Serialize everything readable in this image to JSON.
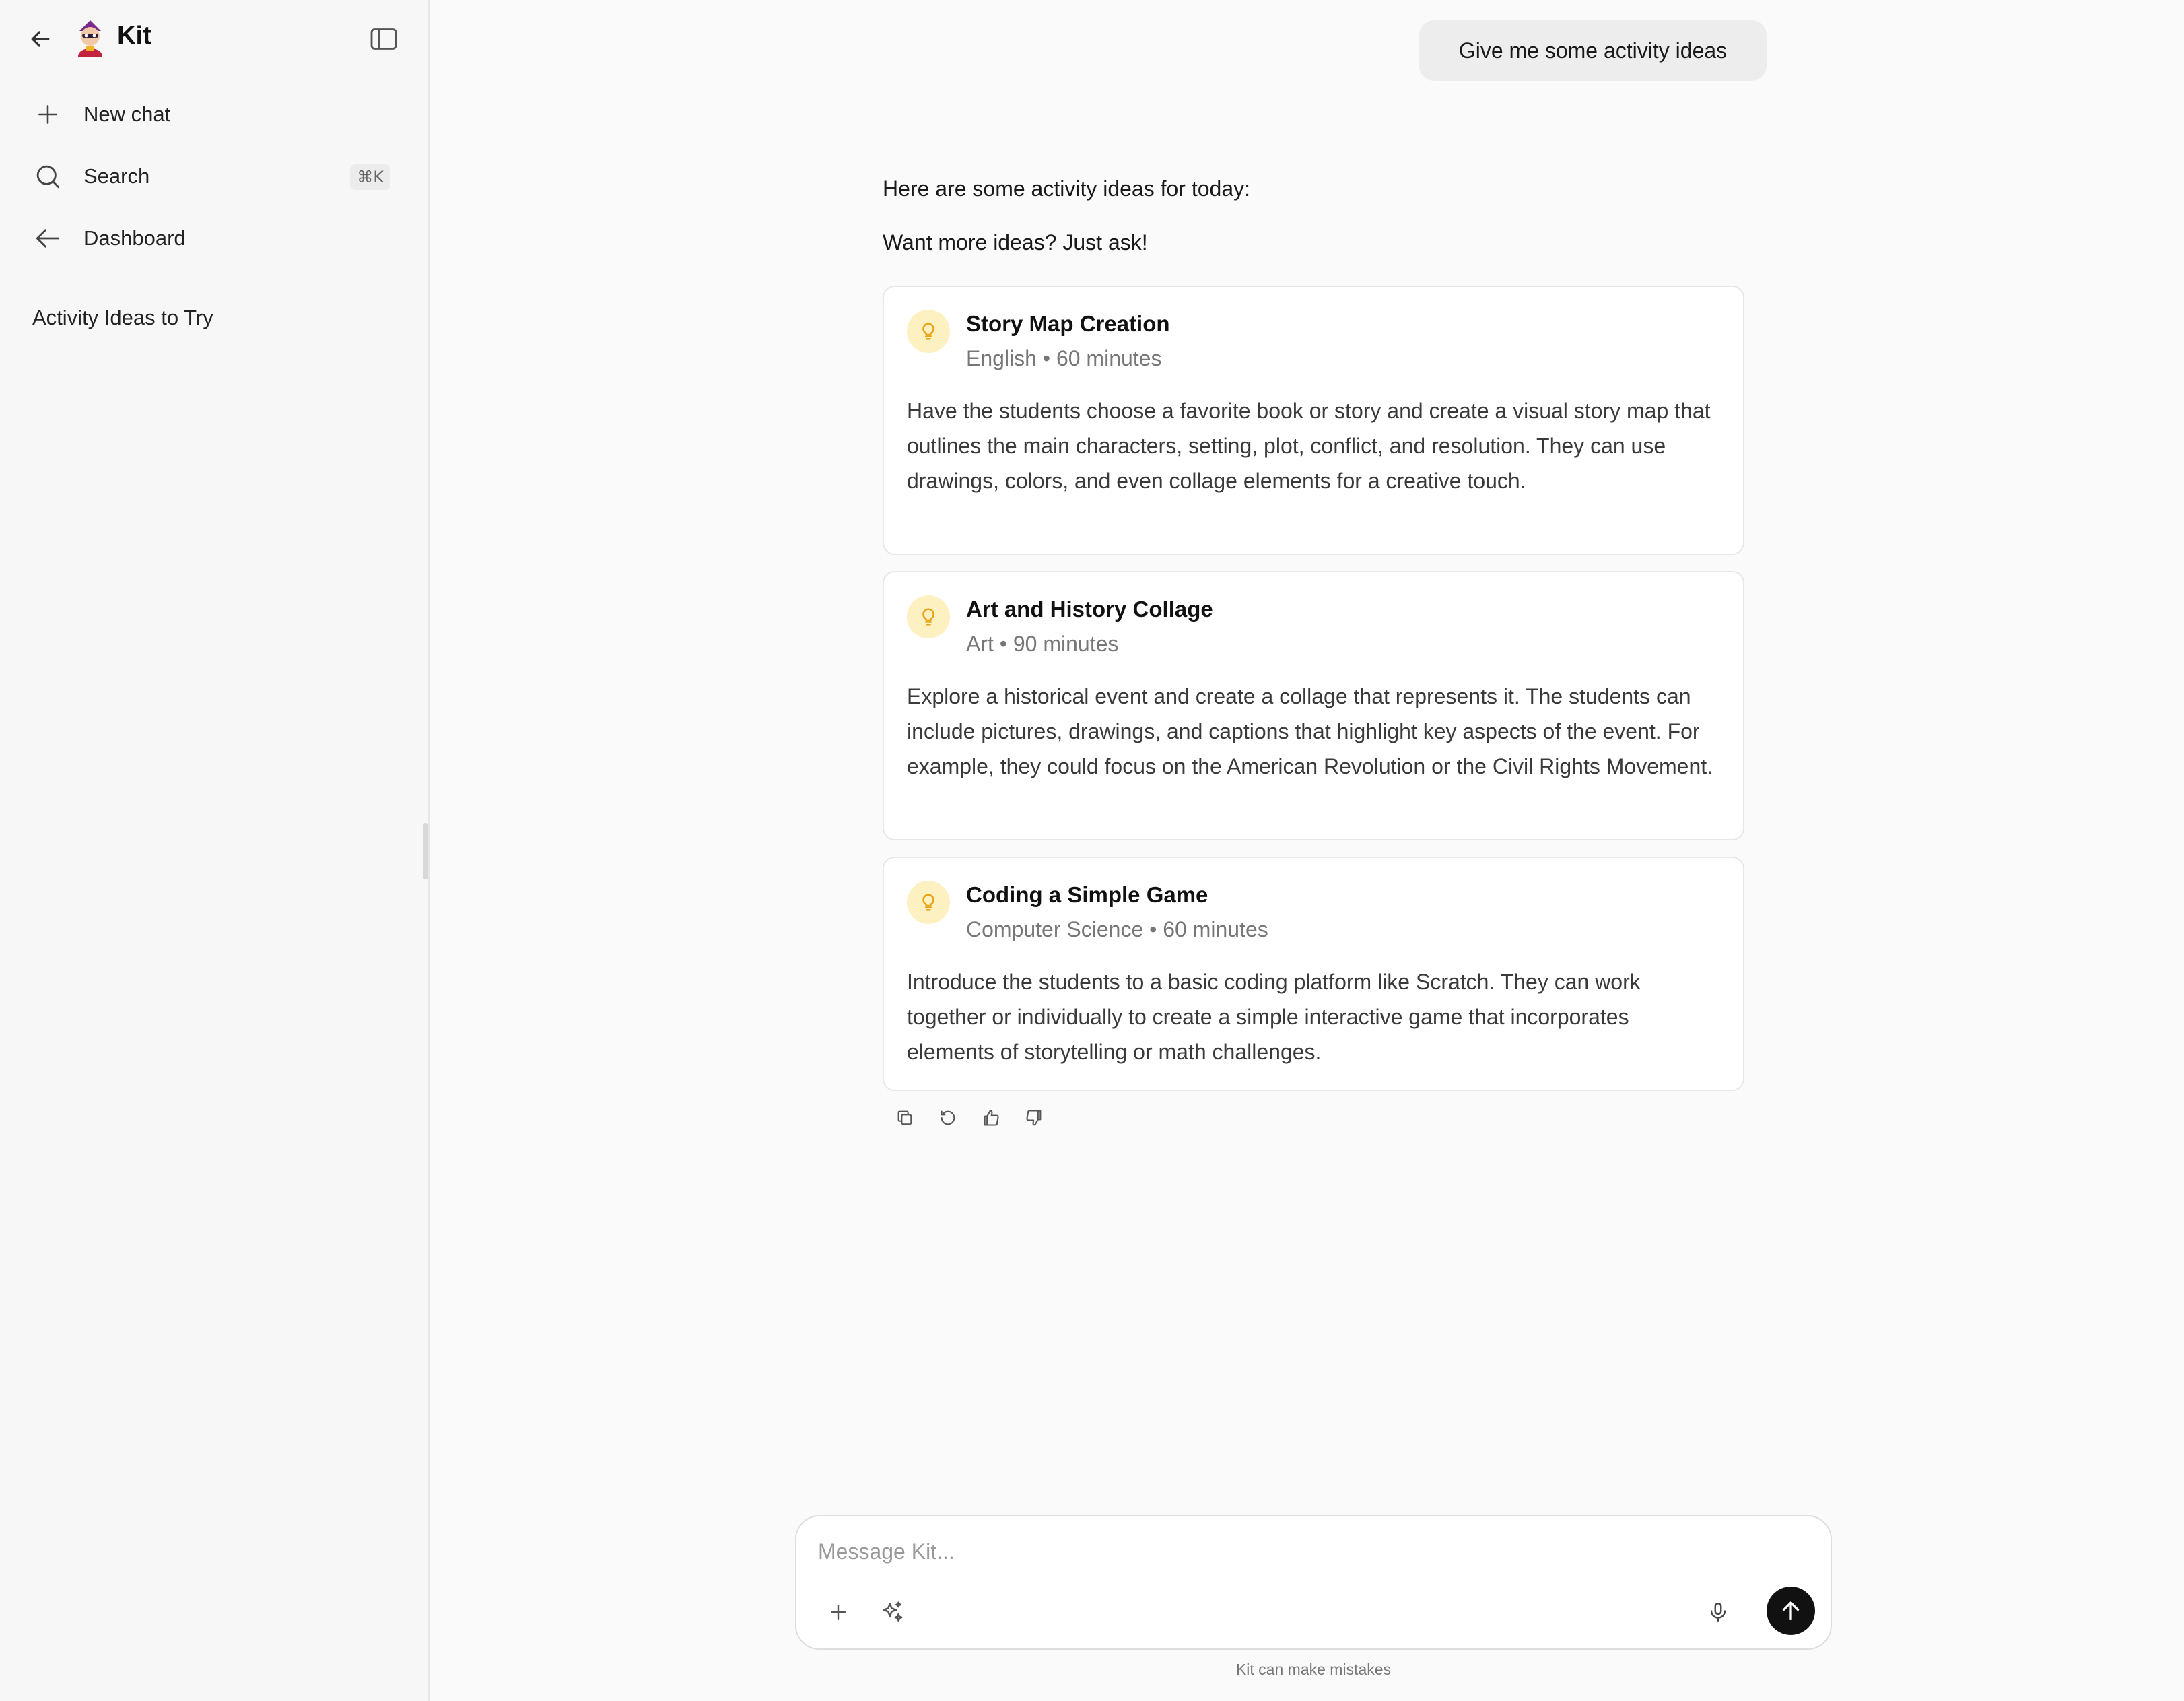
{
  "sidebar": {
    "app_title": "Kit",
    "nav": [
      {
        "label": "New chat",
        "icon": "plus-icon"
      },
      {
        "label": "Search",
        "icon": "search-icon",
        "shortcut": "⌘K"
      },
      {
        "label": "Dashboard",
        "icon": "arrow-left-icon"
      }
    ],
    "history": [
      "Activity Ideas to Try"
    ]
  },
  "chat": {
    "user_message": "Give me some activity ideas",
    "intro_line1": "Here are some activity ideas for today:",
    "intro_line2": "Want more ideas? Just ask!",
    "cards": [
      {
        "title": "Story Map Creation",
        "meta": "English • 60 minutes",
        "description": "Have the students choose a favorite book or story and create a visual story map that outlines the main characters, setting, plot, conflict, and resolution. They can use drawings, colors, and even collage elements for a creative touch."
      },
      {
        "title": "Art and History Collage",
        "meta": "Art • 90 minutes",
        "description": "Explore a historical event and create a collage that represents it. The students can include pictures, drawings, and captions that highlight key aspects of the event. For example, they could focus on the American Revolution or the Civil Rights Movement."
      },
      {
        "title": "Coding a Simple Game",
        "meta": "Computer Science • 60 minutes",
        "description": "Introduce the students to a basic coding platform like Scratch. They can work together or individually to create a simple interactive game that incorporates elements of storytelling or math challenges."
      }
    ],
    "message_actions": [
      "copy-icon",
      "regenerate-icon",
      "thumbs-up-icon",
      "thumbs-down-icon"
    ]
  },
  "composer": {
    "placeholder": "Message Kit...",
    "value": "",
    "disclaimer": "Kit can make mistakes"
  },
  "colors": {
    "accent_bulb_bg": "#fdf1c2",
    "accent_bulb_icon": "#e8a317",
    "send_button": "#111111"
  }
}
